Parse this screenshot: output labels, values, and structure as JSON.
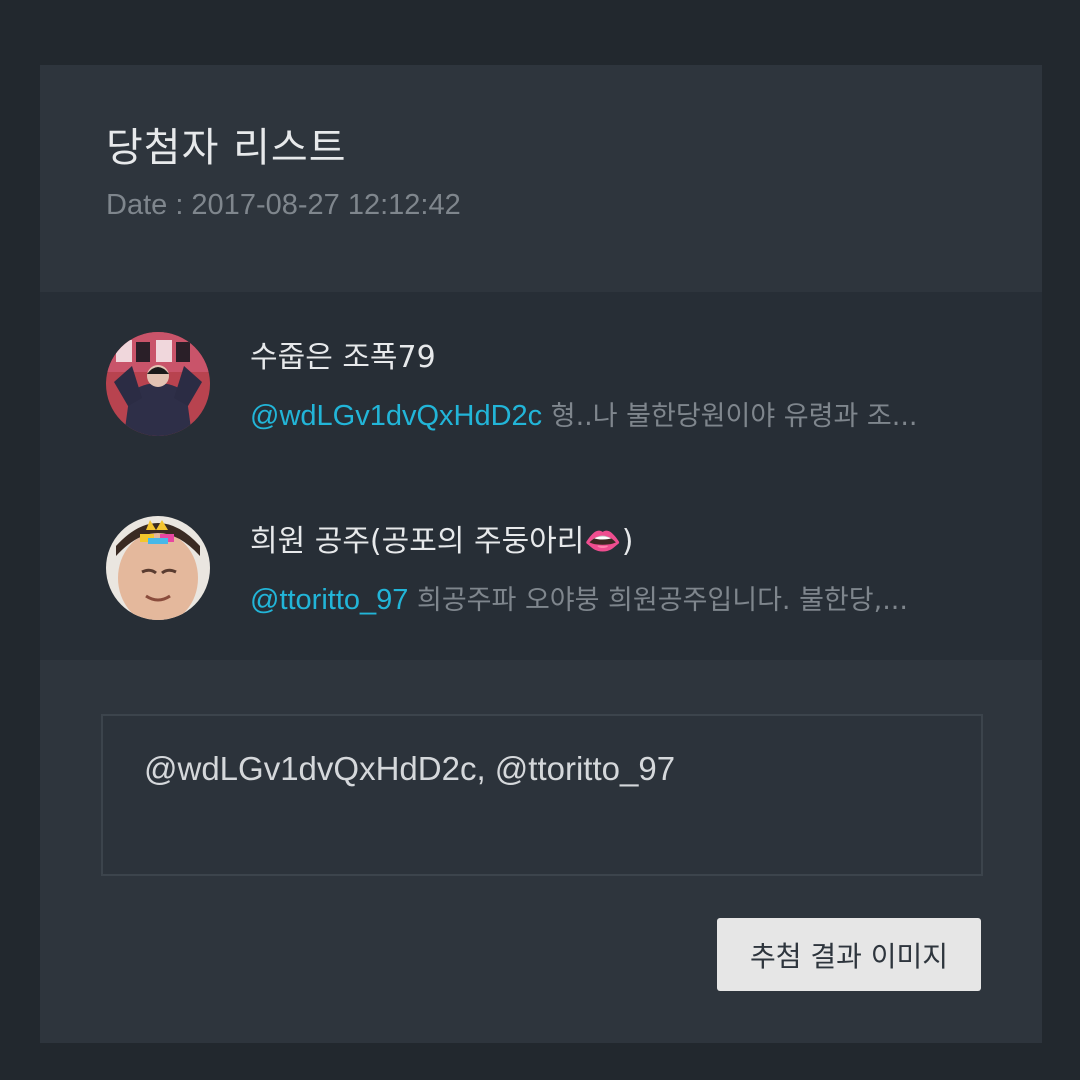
{
  "header": {
    "title": "당첨자 리스트",
    "date": "Date : 2017-08-27 12:12:42"
  },
  "winners": [
    {
      "name": "수줍은 조폭79",
      "handle": "@wdLGv1dvQxHdD2c",
      "snippet": " 형..나 불한당원이야 유령과 조..."
    },
    {
      "name": "희원 공주(공포의 주둥아리",
      "name_emoji": "👄",
      "name_close": ")",
      "handle": "@ttoritto_97",
      "snippet": " 희공주파 오야붕 희원공주입니다. 불한당,..."
    }
  ],
  "result": {
    "text": "@wdLGv1dvQxHdD2c, @ttoritto_97"
  },
  "actions": {
    "image_button_label": "추첨 결과 이미지"
  },
  "colors": {
    "background": "#22282e",
    "card": "#2e353d",
    "list": "#272e36",
    "handle": "#22b5d8",
    "muted": "#7f868d",
    "button": "#e6e6e6"
  }
}
